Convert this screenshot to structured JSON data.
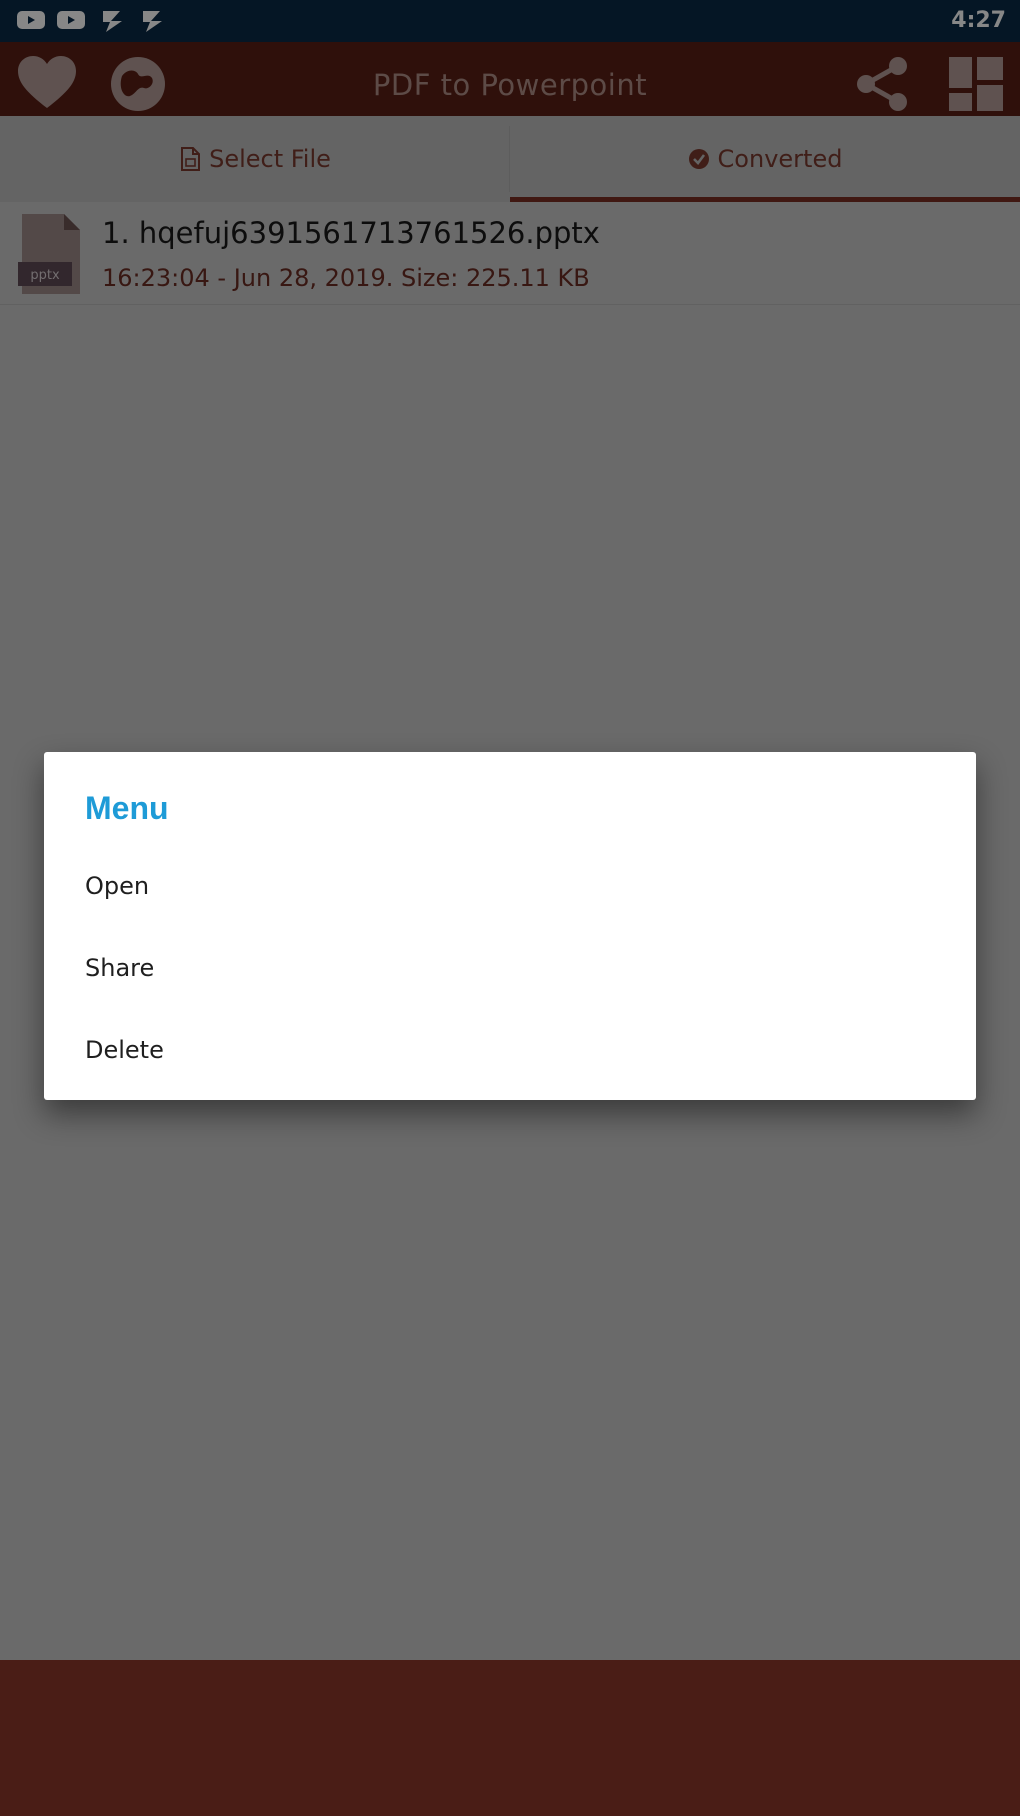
{
  "status_bar": {
    "time": "4:27",
    "icons": [
      "youtube-icon",
      "youtube-icon",
      "app-notification-icon",
      "app-notification-icon"
    ]
  },
  "app_bar": {
    "title": "PDF to Powerpoint",
    "icons": [
      "heart-icon",
      "globe-icon",
      "share-icon",
      "grid-icon"
    ],
    "color": "#5a1f16"
  },
  "tabs": [
    {
      "label": "Select File",
      "icon": "file-icon",
      "selected": false
    },
    {
      "label": "Converted",
      "icon": "check-circle-icon",
      "selected": true
    }
  ],
  "files": [
    {
      "name": "1. hqefuj6391561713761526.pptx",
      "meta": "16:23:04 - Jun 28, 2019. Size: 225.11 KB",
      "icon_label": "pptx"
    }
  ],
  "dialog": {
    "title": "Menu",
    "title_color": "#1e9bd7",
    "items": [
      "Open",
      "Share",
      "Delete"
    ]
  }
}
